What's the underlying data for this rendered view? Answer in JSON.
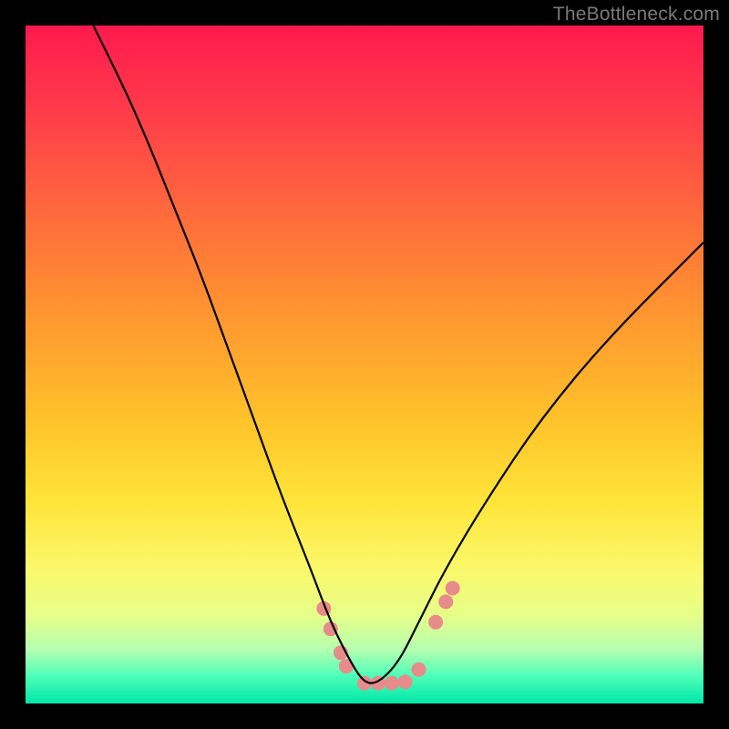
{
  "watermark": "TheBottleneck.com",
  "chart_data": {
    "type": "line",
    "title": "",
    "xlabel": "",
    "ylabel": "",
    "xlim": [
      0,
      100
    ],
    "ylim": [
      0,
      100
    ],
    "background_gradient": {
      "top_color": "#ff1a4d",
      "bottom_color": "#00e6a8",
      "mid_zone_color": "#ffe438"
    },
    "series": [
      {
        "name": "bottleneck-curve",
        "color": "#000000",
        "x": [
          10,
          14,
          18,
          22,
          26,
          30,
          34,
          38,
          42,
          45,
          48,
          50,
          52,
          55,
          58,
          62,
          68,
          76,
          86,
          100
        ],
        "y": [
          100,
          92,
          83,
          73,
          63,
          52,
          41,
          30,
          20,
          12,
          6,
          3,
          3,
          6,
          12,
          20,
          30,
          42,
          54,
          68
        ]
      }
    ],
    "markers": {
      "name": "highlight-dots",
      "color": "#e78b8b",
      "points": [
        {
          "x": 44.0,
          "y": 14.0
        },
        {
          "x": 45.0,
          "y": 11.0
        },
        {
          "x": 46.5,
          "y": 7.5
        },
        {
          "x": 47.3,
          "y": 5.5
        },
        {
          "x": 50.0,
          "y": 3.0
        },
        {
          "x": 52.0,
          "y": 3.0
        },
        {
          "x": 54.0,
          "y": 3.0
        },
        {
          "x": 56.0,
          "y": 3.2
        },
        {
          "x": 58.0,
          "y": 5.0
        },
        {
          "x": 60.5,
          "y": 12.0
        },
        {
          "x": 62.0,
          "y": 15.0
        },
        {
          "x": 63.0,
          "y": 17.0
        }
      ],
      "radius": 8
    }
  }
}
